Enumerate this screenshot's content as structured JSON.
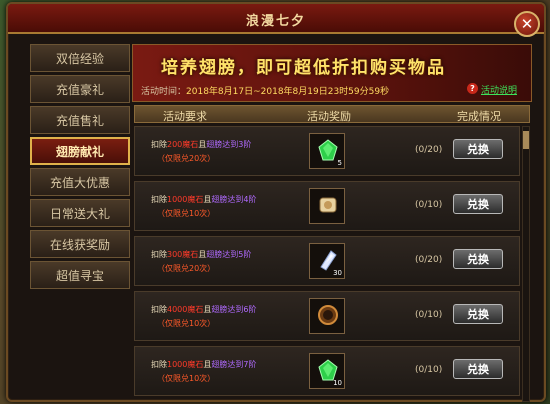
{
  "window": {
    "title": "浪漫七夕",
    "close_label": "✕"
  },
  "sidebar": {
    "items": [
      {
        "label": "双倍经验",
        "active": false
      },
      {
        "label": "充值豪礼",
        "active": false
      },
      {
        "label": "充值售礼",
        "active": false
      },
      {
        "label": "翅膀献礼",
        "active": true
      },
      {
        "label": "充值大优惠",
        "active": false
      },
      {
        "label": "日常送大礼",
        "active": false
      },
      {
        "label": "在线获奖励",
        "active": false
      },
      {
        "label": "超值寻宝",
        "active": false
      }
    ]
  },
  "banner": {
    "headline": "培养翅膀，即可超低折扣购买物品",
    "time_label": "活动时间：",
    "time_value": "2018年8月17日~2018年8月19日23时59分59秒",
    "help_icon": "?",
    "link_label": "活动说明"
  },
  "table": {
    "headers": [
      "活动要求",
      "活动奖励",
      "完成情况"
    ]
  },
  "rows": [
    {
      "req_prefix": "扣除",
      "req_cost": "200魔石",
      "req_mid": "且",
      "req_cond": "翅膀达到3阶",
      "req_limit": "（仅限兑20次）",
      "qty": "5",
      "progress": "(0/20)",
      "button": "兑换",
      "gem": "green-gem"
    },
    {
      "req_prefix": "扣除",
      "req_cost": "1000魔石",
      "req_mid": "且",
      "req_cond": "翅膀达到4阶",
      "req_limit": "（仅限兑10次）",
      "qty": "",
      "progress": "(0/10)",
      "button": "兑换",
      "gem": "scroll-item"
    },
    {
      "req_prefix": "扣除",
      "req_cost": "300魔石",
      "req_mid": "且",
      "req_cond": "翅膀达到5阶",
      "req_limit": "（仅限兑20次）",
      "qty": "30",
      "progress": "(0/20)",
      "button": "兑换",
      "gem": "crystal-shard"
    },
    {
      "req_prefix": "扣除",
      "req_cost": "4000魔石",
      "req_mid": "且",
      "req_cond": "翅膀达到6阶",
      "req_limit": "（仅限兑10次）",
      "qty": "",
      "progress": "(0/10)",
      "button": "兑换",
      "gem": "bronze-ring"
    },
    {
      "req_prefix": "扣除",
      "req_cost": "1000魔石",
      "req_mid": "且",
      "req_cond": "翅膀达到7阶",
      "req_limit": "（仅限兑10次）",
      "qty": "10",
      "progress": "(0/10)",
      "button": "兑换",
      "gem": "green-gem"
    }
  ],
  "colors": {
    "accent": "#e0b24a",
    "title": "#f3d9a0",
    "banner_headline": "#ffe36a",
    "cost_red": "#ff3a2a",
    "cond_purple": "#b06aff",
    "link_green": "#3ee25a"
  }
}
